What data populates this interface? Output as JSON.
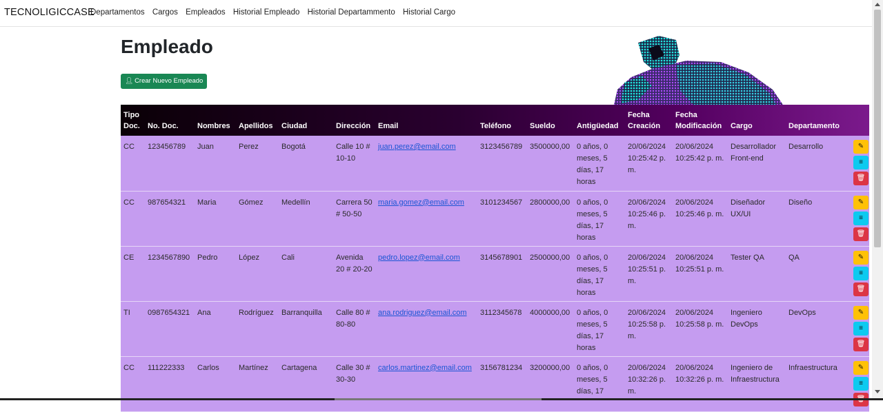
{
  "navbar": {
    "brand": "TECNOLIGICCASE",
    "links": [
      "Departamentos",
      "Cargos",
      "Empleados",
      "Historial Empleado",
      "Historial Departammento",
      "Historial Cargo"
    ]
  },
  "page": {
    "title": "Empleado",
    "create_button": "Crear Nuevo Empleado"
  },
  "table": {
    "headers": [
      "Tipo Doc.",
      "No. Doc.",
      "Nombres",
      "Apellidos",
      "Ciudad",
      "Dirección",
      "Email",
      "Teléfono",
      "Sueldo",
      "Antigüedad",
      "Fecha Creación",
      "Fecha Modificación",
      "Cargo",
      "Departamento",
      ""
    ],
    "rows": [
      [
        "CC",
        "123456789",
        "Juan",
        "Perez",
        "Bogotá",
        "Calle 10 # 10-10",
        "juan.perez@email.com",
        "3123456789",
        "3500000,00",
        "0 años, 0 meses, 5 días, 17 horas",
        "20/06/2024 10:25:42 p. m.",
        "20/06/2024 10:25:42 p. m.",
        "Desarrollador Front-end",
        "Desarrollo"
      ],
      [
        "CC",
        "987654321",
        "Maria",
        "Gómez",
        "Medellín",
        "Carrera 50 # 50-50",
        "maria.gomez@email.com",
        "3101234567",
        "2800000,00",
        "0 años, 0 meses, 5 días, 17 horas",
        "20/06/2024 10:25:46 p. m.",
        "20/06/2024 10:25:46 p. m.",
        "Diseñador UX/UI",
        "Diseño"
      ],
      [
        "CE",
        "1234567890",
        "Pedro",
        "López",
        "Cali",
        "Avenida 20 # 20-20",
        "pedro.lopez@email.com",
        "3145678901",
        "2500000,00",
        "0 años, 0 meses, 5 días, 17 horas",
        "20/06/2024 10:25:51 p. m.",
        "20/06/2024 10:25:51 p. m.",
        "Tester QA",
        "QA"
      ],
      [
        "TI",
        "0987654321",
        "Ana",
        "Rodríguez",
        "Barranquilla",
        "Calle 80 # 80-80",
        "ana.rodriguez@email.com",
        "3112345678",
        "4000000,00",
        "0 años, 0 meses, 5 días, 17 horas",
        "20/06/2024 10:25:58 p. m.",
        "20/06/2024 10:25:58 p. m.",
        "Ingeniero DevOps",
        "DevOps"
      ],
      [
        "CC",
        "111222333",
        "Carlos",
        "Martínez",
        "Cartagena",
        "Calle 30 # 30-30",
        "carlos.martinez@email.com",
        "3156781234",
        "3200000,00",
        "0 años, 0 meses, 5 días, 17",
        "20/06/2024 10:32:26 p. m.",
        "20/06/2024 10:32:26 p. m.",
        "Ingeniero de Infraestructura",
        "Infraestructura"
      ]
    ]
  },
  "icons": {
    "create": "person-add-icon",
    "edit": "pencil-icon",
    "view": "list-icon",
    "delete": "trash-icon"
  },
  "colors": {
    "header_gradient_start": "#0a0006",
    "header_gradient_end": "#7b1a8c",
    "row_background": "#c59cf0",
    "create_button": "#198754",
    "edit_button": "#ffc107",
    "view_button": "#0dcaf0",
    "delete_button": "#dc3545"
  }
}
